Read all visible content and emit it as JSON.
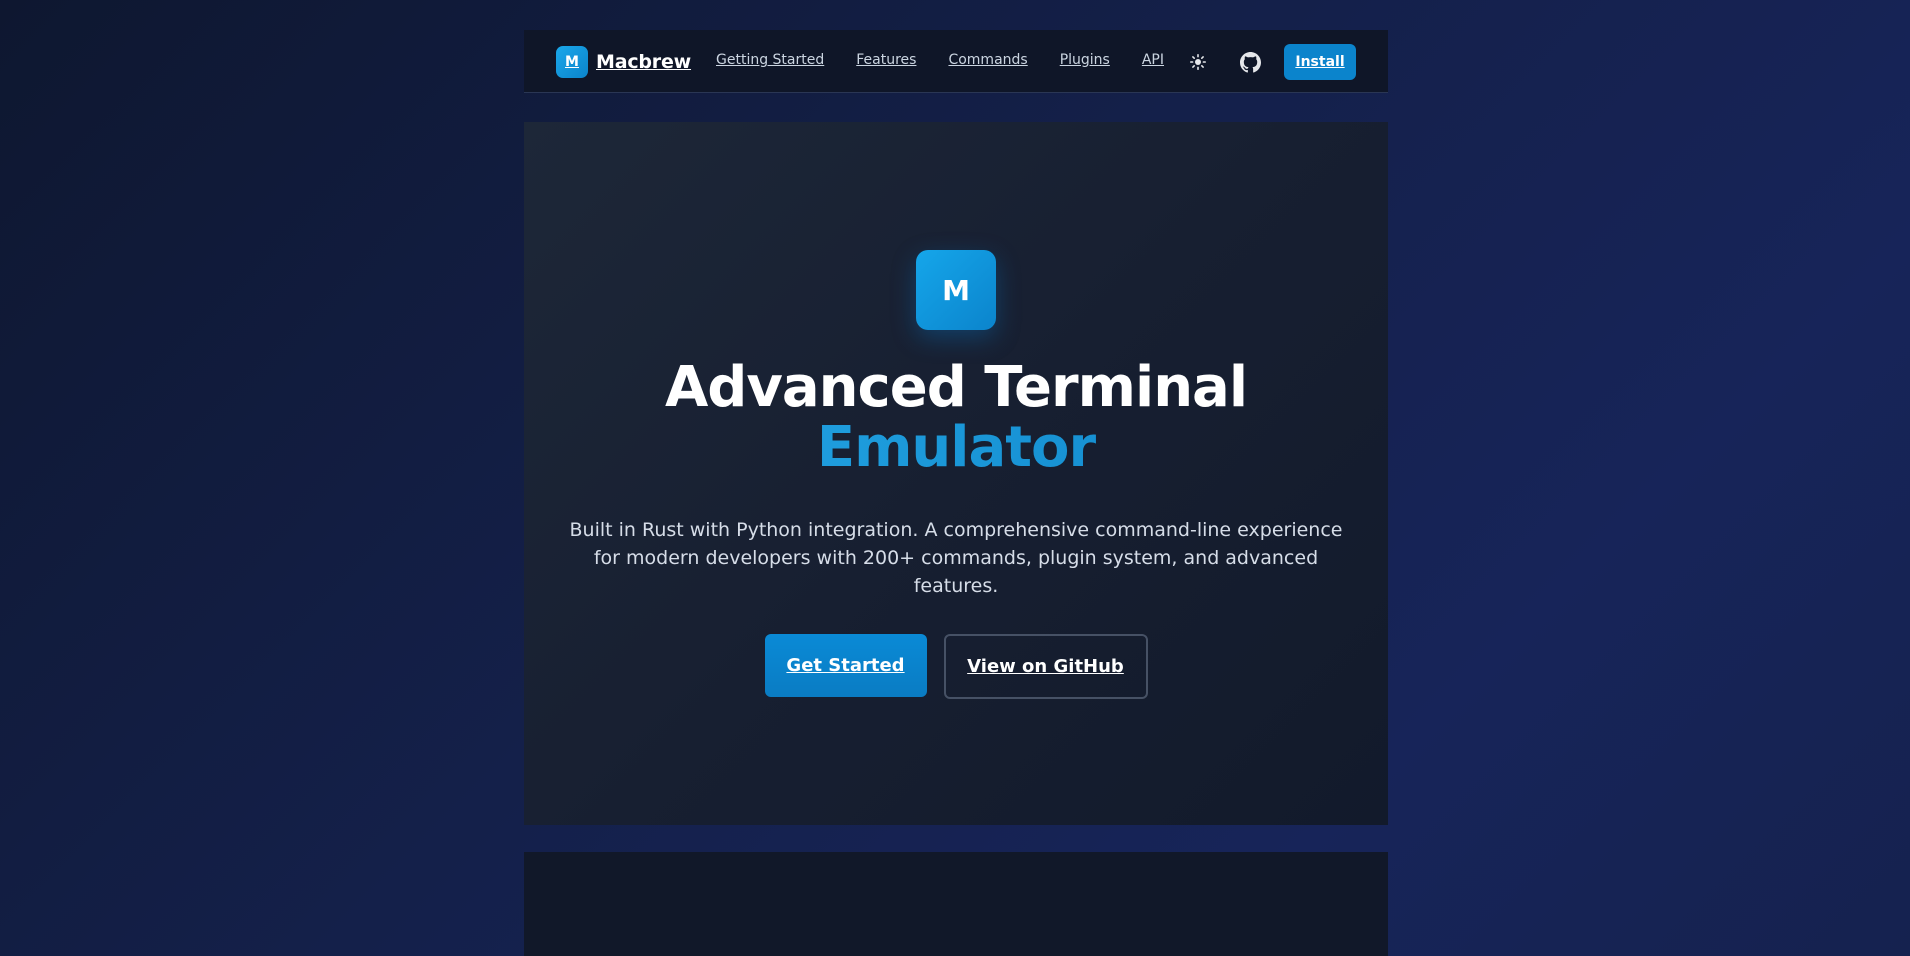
{
  "header": {
    "brand_logo_letter": "M",
    "brand_name": "Macbrew",
    "nav": [
      {
        "label": "Getting Started"
      },
      {
        "label": "Features"
      },
      {
        "label": "Commands"
      },
      {
        "label": "Plugins"
      },
      {
        "label": "API"
      }
    ],
    "theme_toggle_icon": "sun-icon",
    "github_icon": "github-icon",
    "install_label": "Install"
  },
  "hero": {
    "logo_letter": "M",
    "title_line1": "Advanced Terminal",
    "title_line2": "Emulator",
    "description": "Built in Rust with Python integration. A comprehensive command-line experience for modern developers with 200+ commands, plugin system, and advanced features.",
    "primary_cta": "Get Started",
    "secondary_cta": "View on GitHub"
  },
  "colors": {
    "accent": "#0b84cc",
    "accent_light": "#27a9e8",
    "background": "#14204a",
    "panel": "#171f31"
  }
}
